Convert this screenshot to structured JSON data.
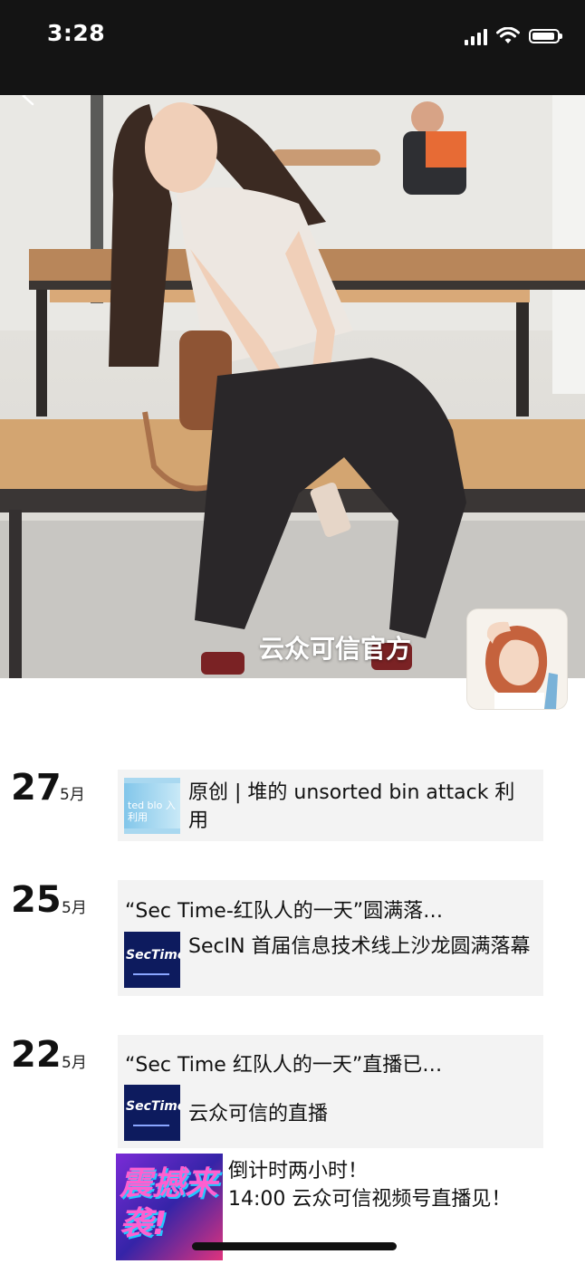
{
  "status_bar": {
    "time": "3:28"
  },
  "profile": {
    "name": "云众可信官方"
  },
  "timeline": [
    {
      "day": "27",
      "month": "5月",
      "items": [
        {
          "thumb_text": "ted blo 入利用",
          "text": "原创 | 堆的 unsorted bin attack 利用"
        }
      ]
    },
    {
      "day": "25",
      "month": "5月",
      "title": "“Sec Time-红队人的一天”圆满落…",
      "items": [
        {
          "thumb_text": "SecTime",
          "text": "SecIN 首届信息技术线上沙龙圆满落幕"
        }
      ]
    },
    {
      "day": "22",
      "month": "5月",
      "title": "“Sec Time 红队人的一天”直播已…",
      "items": [
        {
          "thumb_text": "SecTime",
          "text": "云众可信的直播"
        },
        {
          "thumb_text": "震撼来袭!",
          "text_line1": "倒计时两小时！",
          "text_line2": "14:00 云众可信视频号直播见！"
        }
      ]
    }
  ]
}
